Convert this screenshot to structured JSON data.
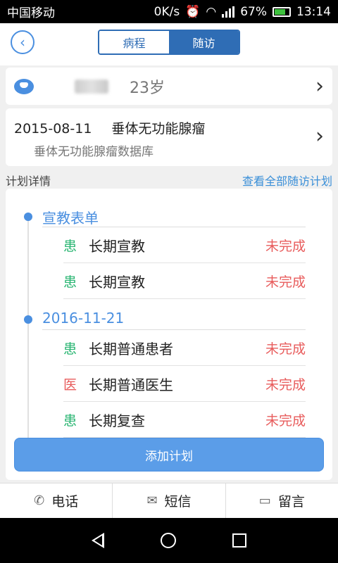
{
  "status_bar": {
    "carrier": "中国移动",
    "speed": "0K/s",
    "network": "4G",
    "battery": "67%",
    "time": "13:14"
  },
  "header": {
    "tabs": [
      {
        "label": "病程",
        "active": false
      },
      {
        "label": "随访",
        "active": true
      }
    ]
  },
  "patient": {
    "age": "23岁"
  },
  "diagnosis": {
    "date": "2015-08-11",
    "name": "垂体无功能腺瘤",
    "database": "垂体无功能腺瘤数据库"
  },
  "plan_section": {
    "title": "计划详情",
    "view_all": "查看全部随访计划"
  },
  "groups": [
    {
      "title": "宣教表单",
      "items": [
        {
          "role": "患",
          "role_type": "patient",
          "name": "长期宣教",
          "status": "未完成"
        },
        {
          "role": "患",
          "role_type": "patient",
          "name": "长期宣教",
          "status": "未完成"
        }
      ]
    },
    {
      "title": "2016-11-21",
      "items": [
        {
          "role": "患",
          "role_type": "patient",
          "name": "长期普通患者",
          "status": "未完成"
        },
        {
          "role": "医",
          "role_type": "doctor",
          "name": "长期普通医生",
          "status": "未完成"
        },
        {
          "role": "患",
          "role_type": "patient",
          "name": "长期复查",
          "status": "未完成"
        }
      ]
    }
  ],
  "add_button": "添加计划",
  "bottom_actions": [
    {
      "label": "电话",
      "icon": "phone-icon"
    },
    {
      "label": "短信",
      "icon": "envelope-icon"
    },
    {
      "label": "留言",
      "icon": "message-icon"
    }
  ],
  "colors": {
    "accent": "#4a8fe0",
    "tab_active": "#2f6db5",
    "status_incomplete": "#e85c5c",
    "role_patient": "#2bb673",
    "role_doctor": "#e85c5c"
  }
}
